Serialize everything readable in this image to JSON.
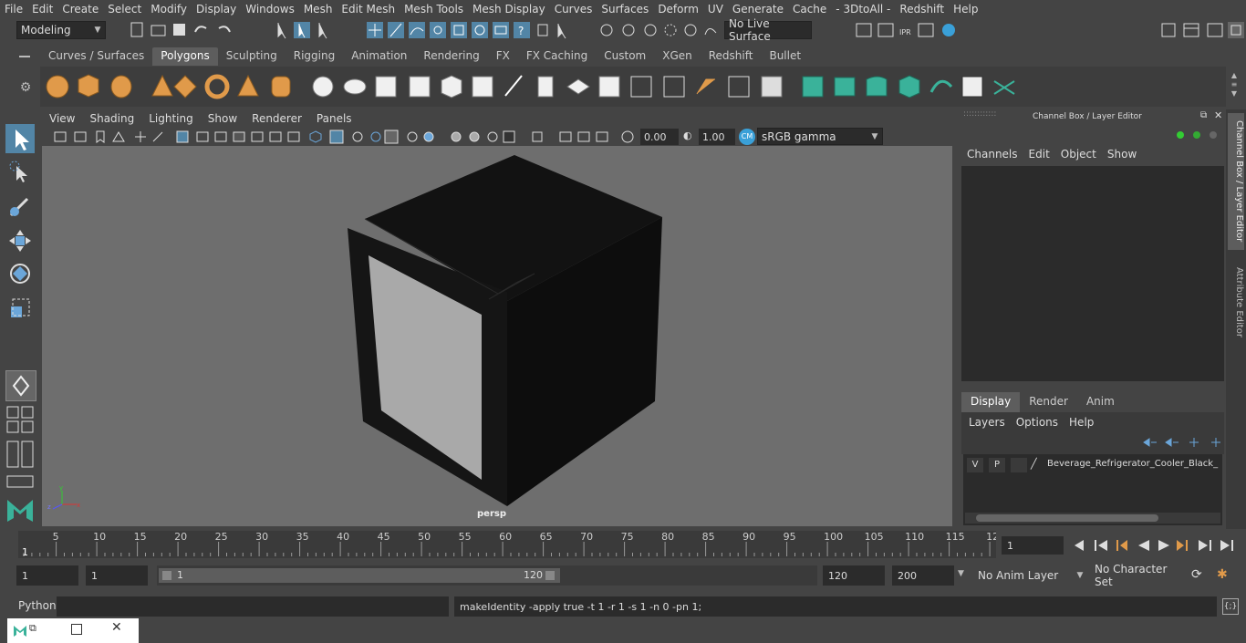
{
  "menu": [
    "File",
    "Edit",
    "Create",
    "Select",
    "Modify",
    "Display",
    "Windows",
    "Mesh",
    "Edit Mesh",
    "Mesh Tools",
    "Mesh Display",
    "Curves",
    "Surfaces",
    "Deform",
    "UV",
    "Generate",
    "Cache",
    "- 3DtoAll -",
    "Redshift",
    "Help"
  ],
  "status": {
    "mode": "Modeling",
    "live_surface": "No Live Surface"
  },
  "shelf_tabs": [
    "Curves / Surfaces",
    "Polygons",
    "Sculpting",
    "Rigging",
    "Animation",
    "Rendering",
    "FX",
    "FX Caching",
    "Custom",
    "XGen",
    "Redshift",
    "Bullet"
  ],
  "shelf_active": "Polygons",
  "panel_menu": [
    "View",
    "Shading",
    "Lighting",
    "Show",
    "Renderer",
    "Panels"
  ],
  "panel_tools": {
    "exposure": "0.00",
    "gamma": "1.00",
    "color_space": "sRGB gamma"
  },
  "viewport": {
    "camera_label": "persp"
  },
  "channel_box": {
    "title": "Channel Box / Layer Editor",
    "menu": [
      "Channels",
      "Edit",
      "Object",
      "Show"
    ],
    "layer_tabs": [
      "Display",
      "Render",
      "Anim"
    ],
    "layer_tab_active": "Display",
    "layer_menu": [
      "Layers",
      "Options",
      "Help"
    ],
    "layer_row": {
      "v": "V",
      "p": "P",
      "name": "Beverage_Refrigerator_Cooler_Black_"
    }
  },
  "side_tabs": [
    "Channel Box / Layer Editor",
    "Attribute Editor"
  ],
  "timeline": {
    "ticks": [
      "5",
      "10",
      "15",
      "20",
      "25",
      "30",
      "35",
      "40",
      "45",
      "50",
      "55",
      "60",
      "65",
      "70",
      "75",
      "80",
      "85",
      "90",
      "95",
      "100",
      "105",
      "110",
      "115",
      "12"
    ],
    "start_label": "1",
    "current_frame": "1"
  },
  "range": {
    "start": "1",
    "playback_start": "1",
    "slider_start": "1",
    "slider_end": "120",
    "playback_end": "120",
    "end": "200",
    "anim_layer": "No Anim Layer",
    "char_set": "No Character Set"
  },
  "cmd": {
    "lang": "Python",
    "output": "makeIdentity -apply true -t 1 -r 1 -s 1 -n 0 -pn 1;"
  },
  "colors": {
    "accent": "#5285a6",
    "icon_orange": "#e09a4a",
    "icon_teal": "#3ab29a",
    "icon_blue": "#6ba6d9"
  }
}
